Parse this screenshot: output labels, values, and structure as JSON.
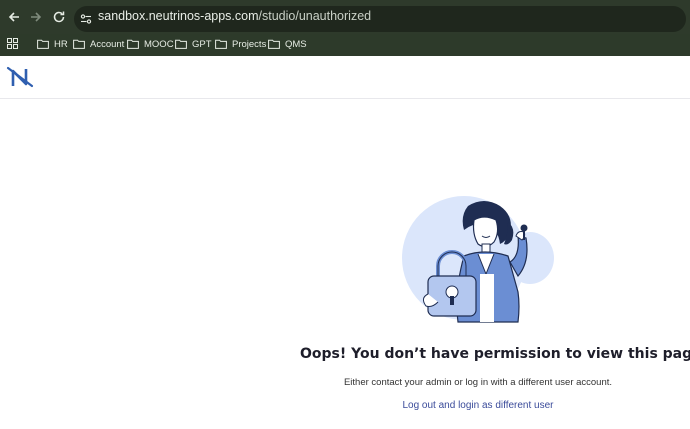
{
  "browser": {
    "url_host": "sandbox.neutrinos-apps.com",
    "url_path": "/studio/unauthorized",
    "bookmarks": [
      "HR",
      "Account",
      "MOOC",
      "GPT",
      "Projects",
      "QMS"
    ]
  },
  "icons": {
    "back": "arrow-left-icon",
    "forward": "arrow-right-icon",
    "reload": "reload-icon",
    "site_info": "tune-icon",
    "apps": "apps-grid-icon",
    "folder": "folder-icon",
    "logo": "neutrinos-logo"
  },
  "colors": {
    "browser_bg": "#2d3a2a",
    "logo": "#2f5fb0",
    "link": "#3a4b9a",
    "illustration_blob": "#dbe6fb",
    "jacket": "#6b8ed3"
  },
  "page": {
    "title": "Oops! You don’t have permission to view this page",
    "description": "Either contact your admin or log in with a different user account.",
    "link_label": "Log out and login as different user"
  }
}
